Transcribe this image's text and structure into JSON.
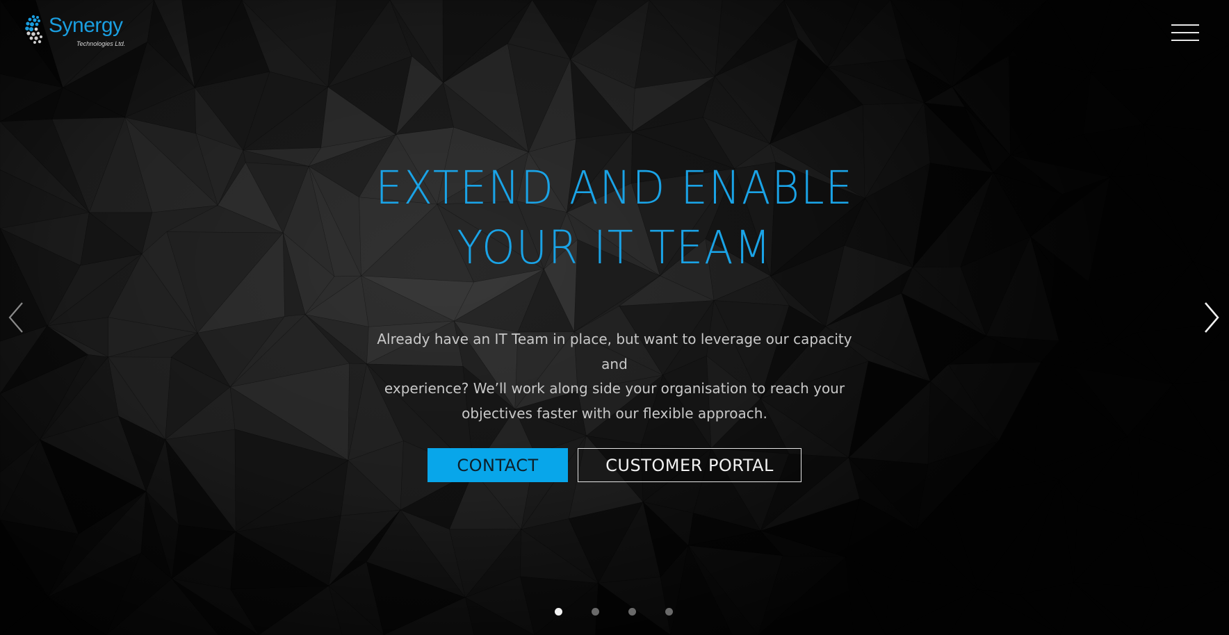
{
  "brand": {
    "name": "Synergy",
    "subtitle": "Technologies Ltd.",
    "color": "#1a9ee0"
  },
  "nav": {
    "menu_icon": "hamburger-menu-icon"
  },
  "hero": {
    "headline_line1": "EXTEND AND ENABLE",
    "headline_line2": "YOUR IT TEAM",
    "headline_color": "#1aa3e6",
    "body_line1": "Already have an IT Team in place, but want to leverage our capacity and",
    "body_line2": "experience? We’ll work along side your organisation to reach your",
    "body_line3": "objectives faster with our flexible approach.",
    "contact_label": "CONTACT",
    "contact_color": "#08a6ea",
    "portal_label": "CUSTOMER PORTAL"
  },
  "carousel": {
    "prev_icon": "chevron-left-icon",
    "next_icon": "chevron-right-icon",
    "slide_count": 4,
    "active_slide": 1
  }
}
